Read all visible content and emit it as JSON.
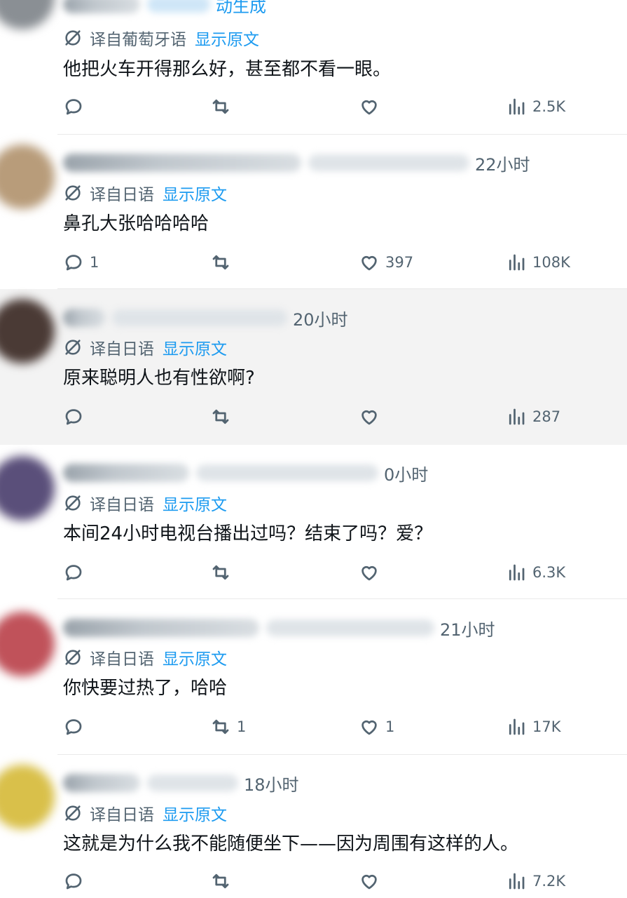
{
  "top_cut_text": "动生成",
  "translate_label_pt": "译自葡萄牙语",
  "translate_label_ja": "译自日语",
  "show_original": "显示原文",
  "posts": [
    {
      "time": "",
      "lang": "pt",
      "text": "他把火车开得那么好，甚至都不看一眼。",
      "replies": "",
      "reposts": "",
      "likes": "",
      "views": "2.5K",
      "avatar_color": "#8a8f94"
    },
    {
      "time": "22小时",
      "lang": "ja",
      "text": "鼻孔大张哈哈哈哈",
      "replies": "1",
      "reposts": "",
      "likes": "397",
      "views": "108K",
      "avatar_color": "#b89c7a"
    },
    {
      "time": "20小时",
      "lang": "ja",
      "text": "原来聪明人也有性欲啊?",
      "replies": "",
      "reposts": "",
      "likes": "",
      "views": "287",
      "avatar_color": "#4a3a35"
    },
    {
      "time": "0小时",
      "lang": "ja",
      "text": "本间24小时电视台播出过吗？结束了吗？爱？",
      "replies": "",
      "reposts": "",
      "likes": "",
      "views": "6.3K",
      "avatar_color": "#5a4f7a"
    },
    {
      "time": "21小时",
      "lang": "ja",
      "text": "你快要过热了，哈哈",
      "replies": "",
      "reposts": "1",
      "likes": "1",
      "views": "17K",
      "avatar_color": "#c0525a"
    },
    {
      "time": "18小时",
      "lang": "ja",
      "text": "这就是为什么我不能随便坐下——因为周围有这样的人。",
      "replies": "",
      "reposts": "",
      "likes": "",
      "views": "7.2K",
      "avatar_color": "#d9c04a"
    }
  ]
}
